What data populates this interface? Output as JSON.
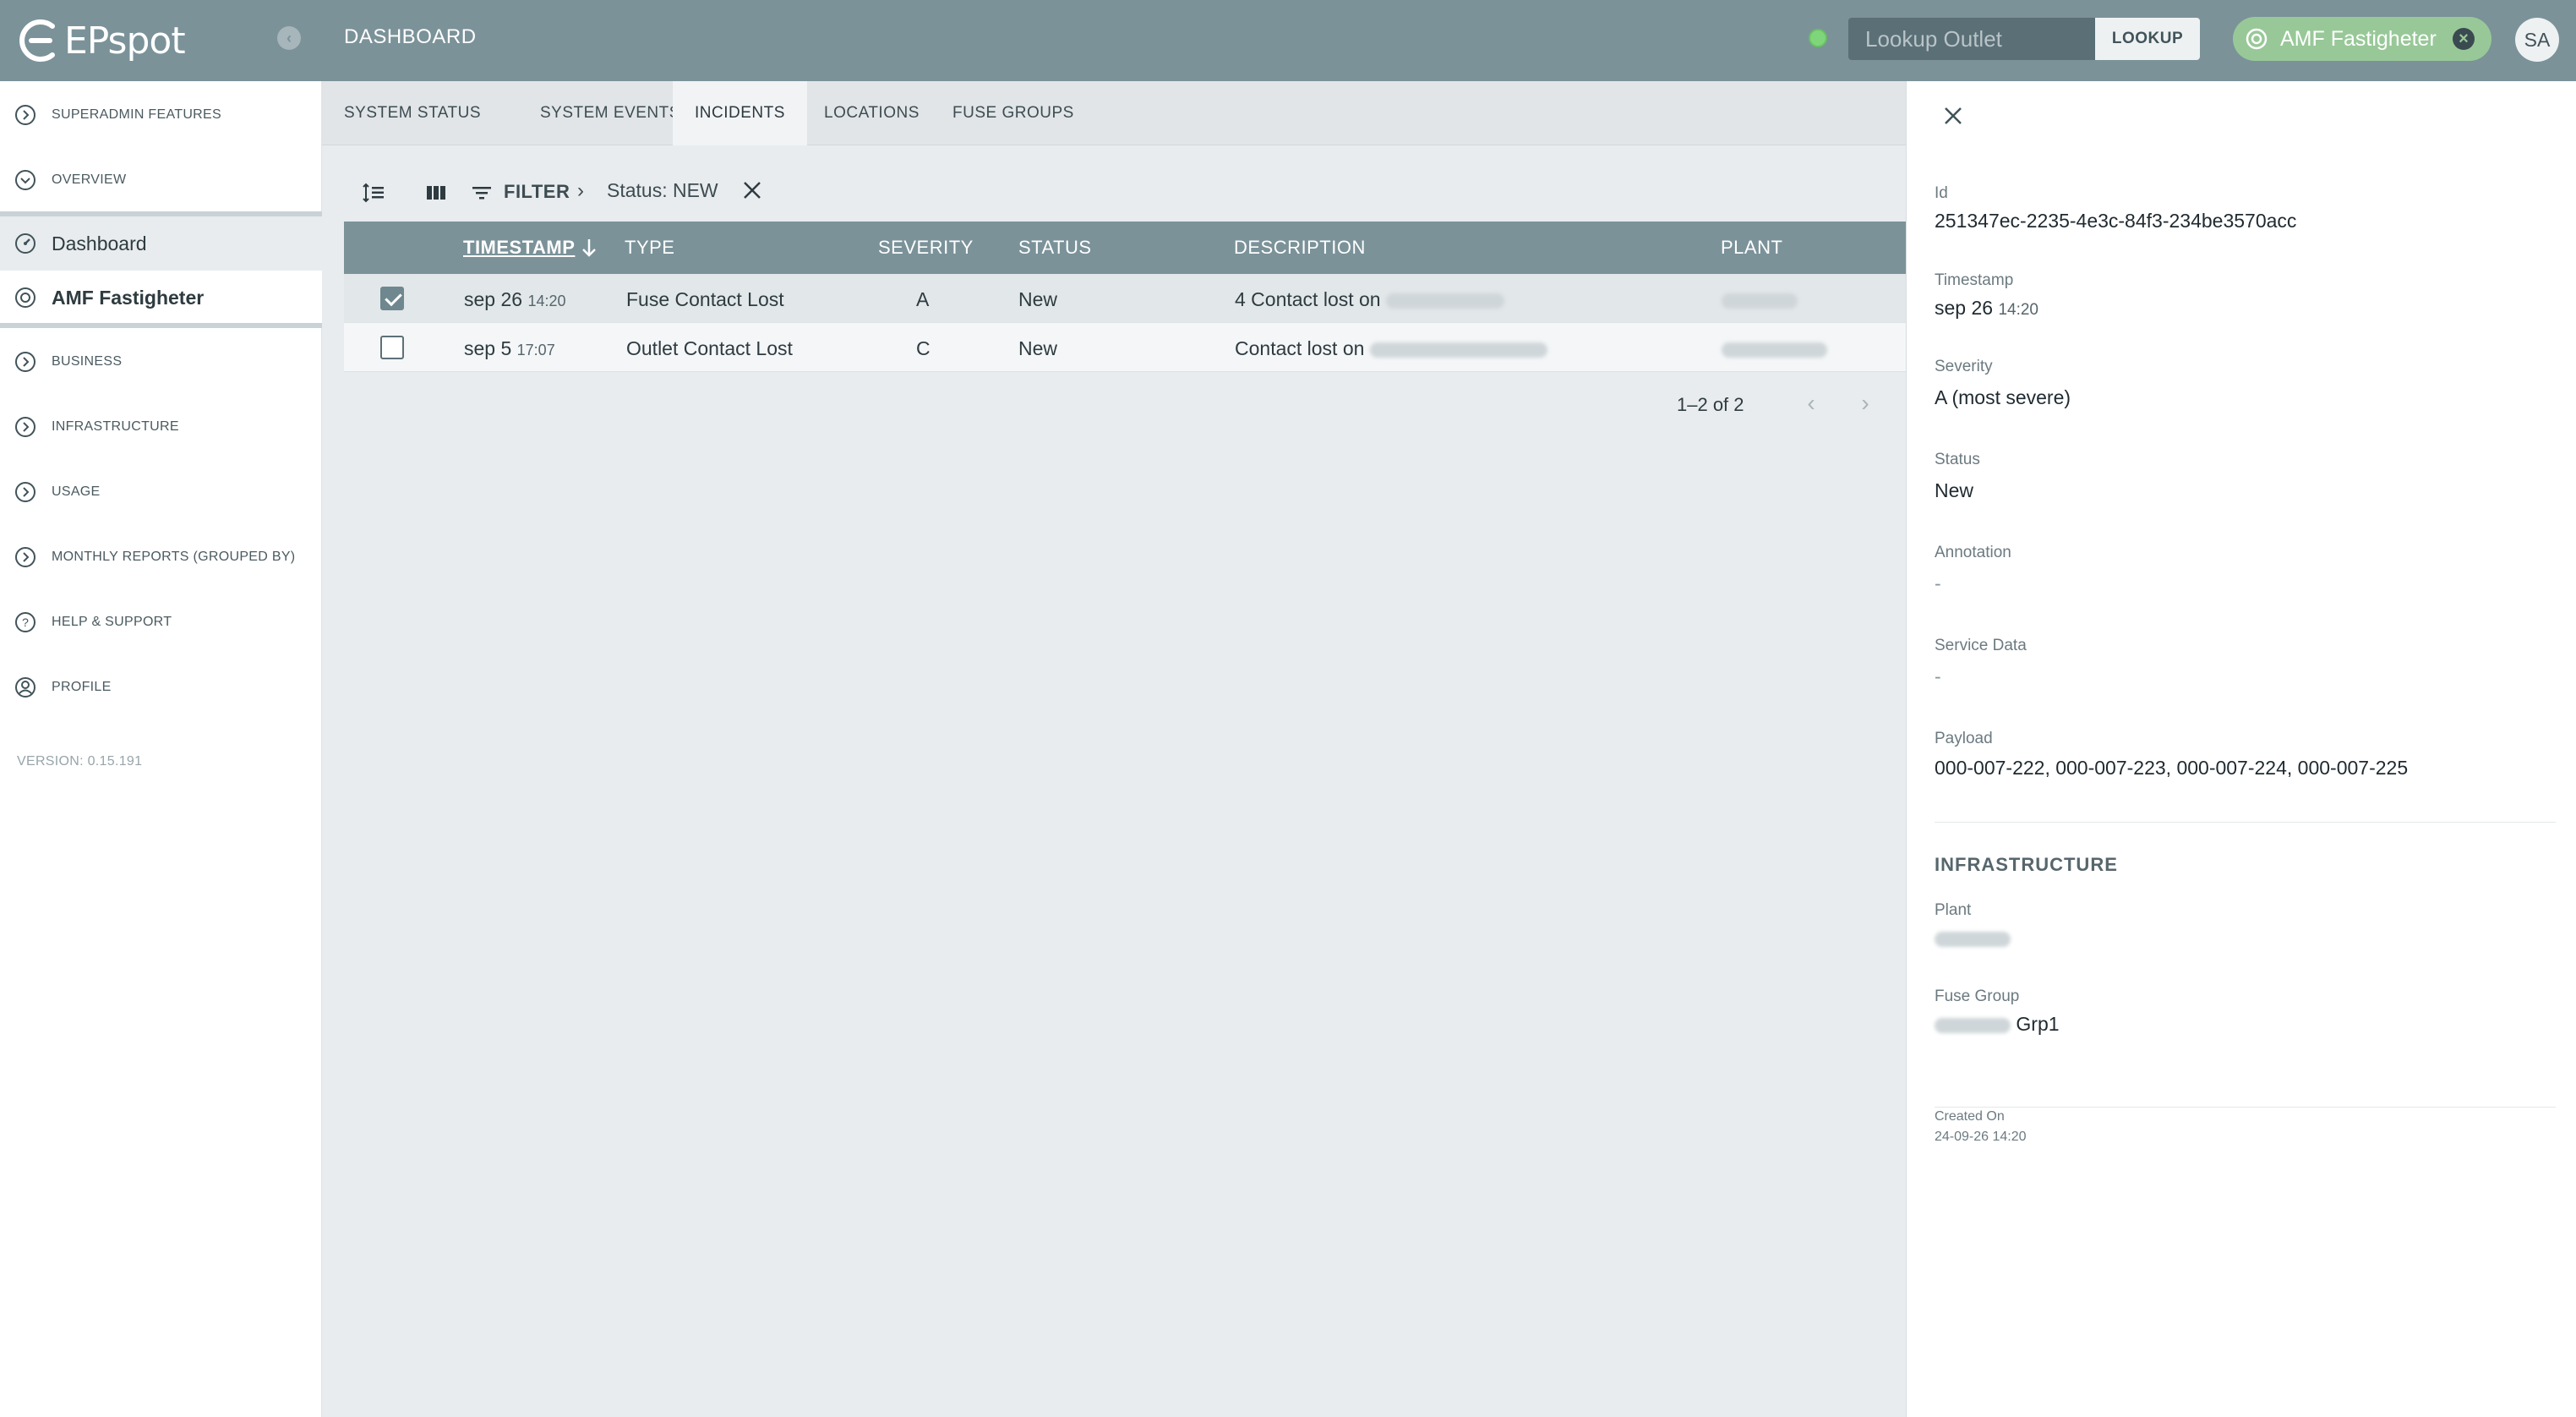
{
  "app": {
    "brand": "EPspot",
    "page_title": "DASHBOARD"
  },
  "header": {
    "lookup_placeholder": "Lookup Outlet",
    "lookup_button": "LOOKUP",
    "site_chip": "AMF Fastigheter",
    "avatar_initials": "SA",
    "status_color": "#7fd67a"
  },
  "sidebar": {
    "items": [
      {
        "label": "SUPERADMIN FEATURES",
        "icon": "chevron-circle-icon"
      },
      {
        "label": "OVERVIEW",
        "icon": "chevron-circle-icon"
      },
      {
        "label": "BUSINESS",
        "icon": "chevron-circle-icon"
      },
      {
        "label": "INFRASTRUCTURE",
        "icon": "chevron-circle-icon"
      },
      {
        "label": "USAGE",
        "icon": "chevron-circle-icon"
      },
      {
        "label": "MONTHLY REPORTS (GROUPED BY)",
        "icon": "chevron-circle-icon"
      },
      {
        "label": "HELP & SUPPORT",
        "icon": "help-circle-icon"
      },
      {
        "label": "PROFILE",
        "icon": "profile-icon"
      }
    ],
    "sub_items": [
      {
        "label": "Dashboard",
        "icon": "dashboard-icon"
      },
      {
        "label": "AMF Fastigheter",
        "icon": "site-icon"
      }
    ],
    "version": "VERSION: 0.15.191"
  },
  "tabs": [
    "SYSTEM STATUS",
    "SYSTEM EVENTS",
    "INCIDENTS",
    "LOCATIONS",
    "FUSE GROUPS"
  ],
  "toolbar": {
    "filter_label": "FILTER",
    "active_filter": "Status: NEW"
  },
  "table": {
    "columns": [
      "TIMESTAMP",
      "TYPE",
      "SEVERITY",
      "STATUS",
      "DESCRIPTION",
      "PLANT"
    ],
    "rows": [
      {
        "selected": true,
        "date": "sep 26",
        "time": "14:20",
        "type": "Fuse Contact Lost",
        "severity": "A",
        "status": "New",
        "description": "4 Contact lost on"
      },
      {
        "selected": false,
        "date": "sep 5",
        "time": "17:07",
        "type": "Outlet Contact Lost",
        "severity": "C",
        "status": "New",
        "description": "Contact lost on"
      }
    ],
    "pagination": "1–2 of 2"
  },
  "detail": {
    "id_label": "Id",
    "id_value": "251347ec-2235-4e3c-84f3-234be3570acc",
    "timestamp_label": "Timestamp",
    "timestamp_date": "sep 26",
    "timestamp_time": "14:20",
    "severity_label": "Severity",
    "severity_value": "A (most severe)",
    "status_label": "Status",
    "status_value": "New",
    "annotation_label": "Annotation",
    "annotation_value": "-",
    "service_label": "Service Data",
    "service_value": "-",
    "payload_label": "Payload",
    "payload_value": "000-007-222, 000-007-223, 000-007-224, 000-007-225",
    "infra_title": "INFRASTRUCTURE",
    "plant_label": "Plant",
    "fuse_group_label": "Fuse Group",
    "fuse_group_value": "Grp1",
    "created_label": "Created On",
    "created_value": "24-09-26 14:20"
  }
}
